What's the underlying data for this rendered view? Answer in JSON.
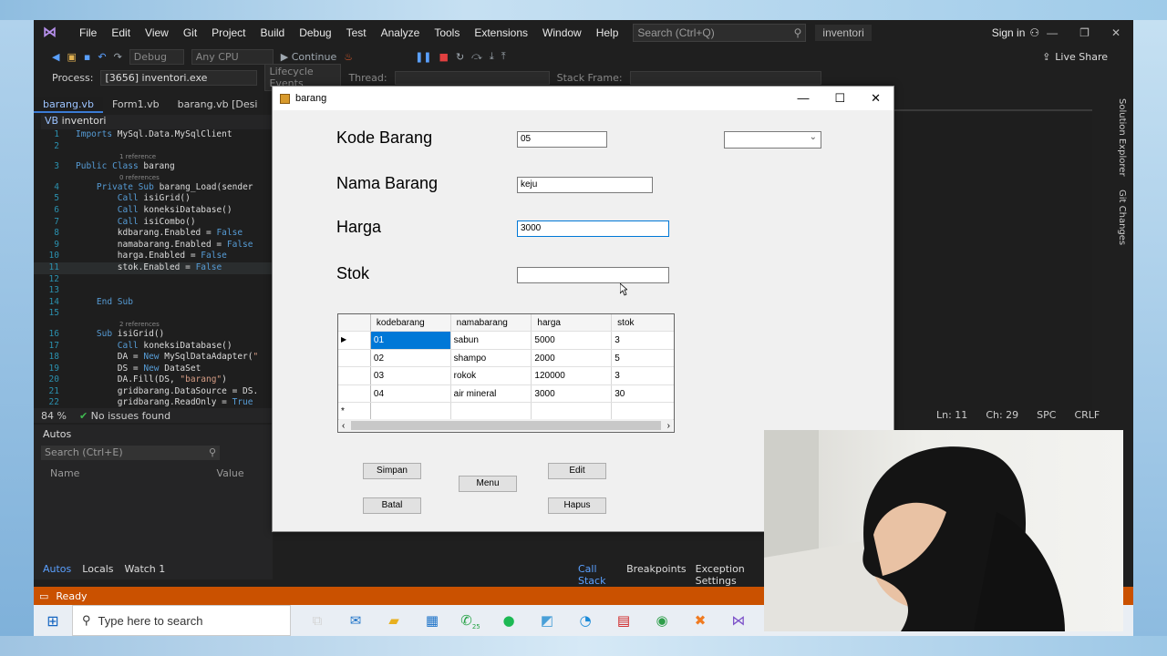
{
  "ide": {
    "menu": [
      "File",
      "Edit",
      "View",
      "Git",
      "Project",
      "Build",
      "Debug",
      "Test",
      "Analyze",
      "Tools",
      "Extensions",
      "Window",
      "Help"
    ],
    "search_placeholder": "Search (Ctrl+Q)",
    "solution_name": "inventori",
    "sign_in": "Sign in",
    "live_share": "Live Share",
    "toolbar": {
      "config": "Debug",
      "platform": "Any CPU",
      "continue": "Continue"
    },
    "process_label": "Process:",
    "process_value": "[3656] inventori.exe",
    "lifecycle": "Lifecycle Events",
    "thread_label": "Thread:",
    "stack_frame": "Stack Frame:",
    "tabs": [
      "barang.vb",
      "Form1.vb",
      "barang.vb [Desi"
    ],
    "nav_class": "inventori",
    "code_lines": [
      {
        "n": "1",
        "t": "Imports MySql.Data.MySqlClient"
      },
      {
        "n": "2",
        "t": ""
      },
      {
        "hint": "1 reference"
      },
      {
        "n": "3",
        "t": "Public Class barang"
      },
      {
        "hint": "0 references"
      },
      {
        "n": "4",
        "t": "    Private Sub barang_Load(sender"
      },
      {
        "n": "5",
        "t": "        Call isiGrid()"
      },
      {
        "n": "6",
        "t": "        Call koneksiDatabase()"
      },
      {
        "n": "7",
        "t": "        Call isiCombo()"
      },
      {
        "n": "8",
        "t": "        kdbarang.Enabled = False"
      },
      {
        "n": "9",
        "t": "        namabarang.Enabled = False"
      },
      {
        "n": "10",
        "t": "        harga.Enabled = False"
      },
      {
        "n": "11",
        "t": "        stok.Enabled = False"
      },
      {
        "n": "12",
        "t": ""
      },
      {
        "n": "13",
        "t": ""
      },
      {
        "n": "14",
        "t": "    End Sub"
      },
      {
        "n": "15",
        "t": ""
      },
      {
        "hint": "2 references"
      },
      {
        "n": "16",
        "t": "    Sub isiGrid()"
      },
      {
        "n": "17",
        "t": "        Call koneksiDatabase()"
      },
      {
        "n": "18",
        "t": "        DA = New MySqlDataAdapter(\""
      },
      {
        "n": "19",
        "t": "        DS = New DataSet"
      },
      {
        "n": "20",
        "t": "        DA.Fill(DS, \"barang\")"
      },
      {
        "n": "21",
        "t": "        gridbarang.DataSource = DS."
      },
      {
        "n": "22",
        "t": "        gridbarang.ReadOnly = True"
      }
    ],
    "status": {
      "zoom": "84 %",
      "issues": "No issues found",
      "line": "Ln: 11",
      "col": "Ch: 29",
      "spc": "SPC",
      "crlf": "CRLF"
    },
    "side_tabs": [
      "Solution Explorer",
      "Git Changes"
    ],
    "autos": {
      "title": "Autos",
      "search": "Search (Ctrl+E)",
      "col_name": "Name",
      "col_value": "Value"
    },
    "bottom_tabs_left": [
      "Autos",
      "Locals",
      "Watch 1"
    ],
    "bottom_tabs_right": [
      "Call Stack",
      "Breakpoints",
      "Exception Settings"
    ],
    "ready": "Ready"
  },
  "taskbar": {
    "search_placeholder": "Type here to search",
    "badge": "25"
  },
  "form": {
    "title": "barang",
    "labels": {
      "kode": "Kode Barang",
      "nama": "Nama Barang",
      "harga": "Harga",
      "stok": "Stok"
    },
    "values": {
      "kode": "05",
      "nama": "keju",
      "harga": "3000",
      "stok": "",
      "combo": ""
    },
    "grid": {
      "headers": [
        "kodebarang",
        "namabarang",
        "harga",
        "stok"
      ],
      "rows": [
        [
          "01",
          "sabun",
          "5000",
          "3"
        ],
        [
          "02",
          "shampo",
          "2000",
          "5"
        ],
        [
          "03",
          "rokok",
          "120000",
          "3"
        ],
        [
          "04",
          "air mineral",
          "3000",
          "30"
        ]
      ],
      "new_row_marker": "*",
      "current_row_marker": "▶"
    },
    "buttons": {
      "simpan": "Simpan",
      "batal": "Batal",
      "menu": "Menu",
      "edit": "Edit",
      "hapus": "Hapus"
    }
  },
  "colors": {
    "ide_bg": "#1f1f1f",
    "status_orange": "#ca5100",
    "accent": "#0078d7",
    "keyword": "#569cd6"
  }
}
